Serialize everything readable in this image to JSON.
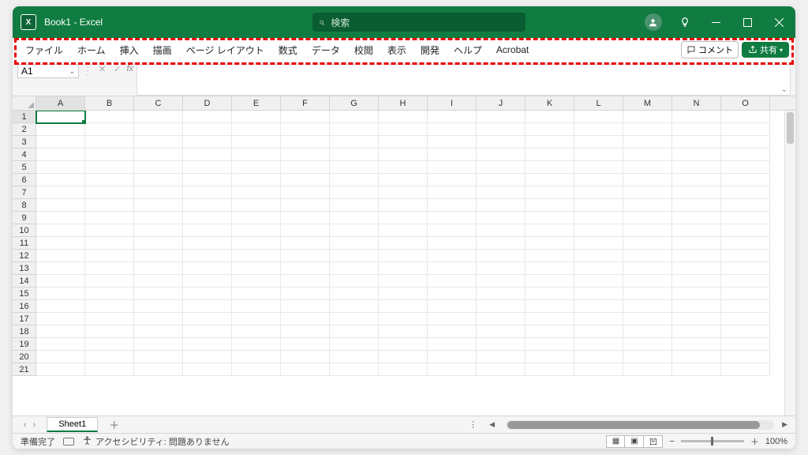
{
  "titlebar": {
    "app_name": "Book1  -  Excel",
    "search_placeholder": "検索"
  },
  "tabs": [
    "ファイル",
    "ホーム",
    "挿入",
    "描画",
    "ページ レイアウト",
    "数式",
    "データ",
    "校閲",
    "表示",
    "開発",
    "ヘルプ",
    "Acrobat"
  ],
  "actions": {
    "comment": "コメント",
    "share": "共有"
  },
  "formula": {
    "name_box": "A1",
    "fx": "fx"
  },
  "columns": [
    "A",
    "B",
    "C",
    "D",
    "E",
    "F",
    "G",
    "H",
    "I",
    "J",
    "K",
    "L",
    "M",
    "N",
    "O"
  ],
  "rows": [
    "1",
    "2",
    "3",
    "4",
    "5",
    "6",
    "7",
    "8",
    "9",
    "10",
    "11",
    "12",
    "13",
    "14",
    "15",
    "16",
    "17",
    "18",
    "19",
    "20",
    "21"
  ],
  "sheet": {
    "tab1": "Sheet1"
  },
  "status": {
    "ready": "準備完了",
    "accessibility": "アクセシビリティ: 問題ありません",
    "zoom": "100%"
  },
  "active_cell": {
    "row": 0,
    "col": 0
  }
}
